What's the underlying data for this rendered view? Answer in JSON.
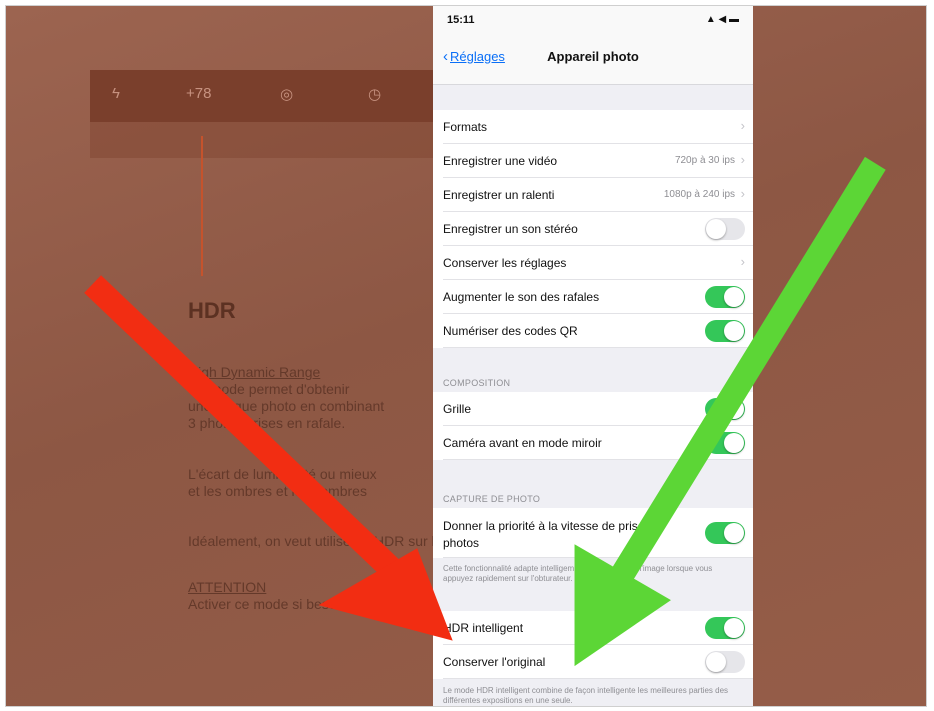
{
  "background_app": {
    "toolbar_items": [
      "ϟ",
      "+78",
      "◎",
      "◷"
    ],
    "hdr_title": "HDR",
    "hdr_lines": [
      "High Dynamic Range",
      "Ce mode permet d'obtenir",
      "une unique photo en combinant",
      "3 photos prises en rafale.",
      "",
      "L'écart de luminosité ou mieux",
      "et les ombres et les sombres",
      "",
      "Idéalement, on veut utiliser le HDR sur les sombres",
      "",
      "ATTENTION",
      "Activer ce mode si besoin"
    ]
  },
  "status_bar": {
    "time": "15:11",
    "icons": "▲ ◀ ▬"
  },
  "nav": {
    "back_label": "Réglages",
    "title": "Appareil photo"
  },
  "rows_top": [
    {
      "label": "Formats",
      "value": "",
      "chevron": true
    },
    {
      "label": "Enregistrer une vidéo",
      "value": "720p à 30 ips",
      "chevron": true
    },
    {
      "label": "Enregistrer un ralenti",
      "value": "1080p à 240 ips",
      "chevron": true
    },
    {
      "label": "Enregistrer un son stéréo",
      "toggle": false
    },
    {
      "label": "Conserver les réglages",
      "value": "",
      "chevron": true
    },
    {
      "label": "Augmenter le son des rafales",
      "toggle": true
    },
    {
      "label": "Numériser des codes QR",
      "toggle": true
    }
  ],
  "composition": {
    "header": "COMPOSITION",
    "rows": [
      {
        "label": "Grille",
        "toggle": true
      },
      {
        "label": "Caméra avant en mode miroir",
        "toggle": true
      }
    ]
  },
  "capture": {
    "header": "CAPTURE DE PHOTO",
    "priority_label": "Donner la priorité à la vitesse de prise de photos",
    "priority_toggle": true,
    "footnote": "Cette fonctionnalité adapte intelligemment la qualité de l'image lorsque vous appuyez rapidement sur l'obturateur."
  },
  "hdr_rows": [
    {
      "label": "HDR intelligent",
      "toggle": true
    },
    {
      "label": "Conserver l'original",
      "toggle": false
    }
  ],
  "hdr_footnote": "Le mode HDR intelligent combine de façon intelligente les meilleures parties des différentes expositions en une seule.",
  "colors": {
    "red_arrow": "#f22d12",
    "green_arrow": "#5cd636",
    "toggle_on": "#34c759",
    "link_blue": "#0a6ff7"
  }
}
